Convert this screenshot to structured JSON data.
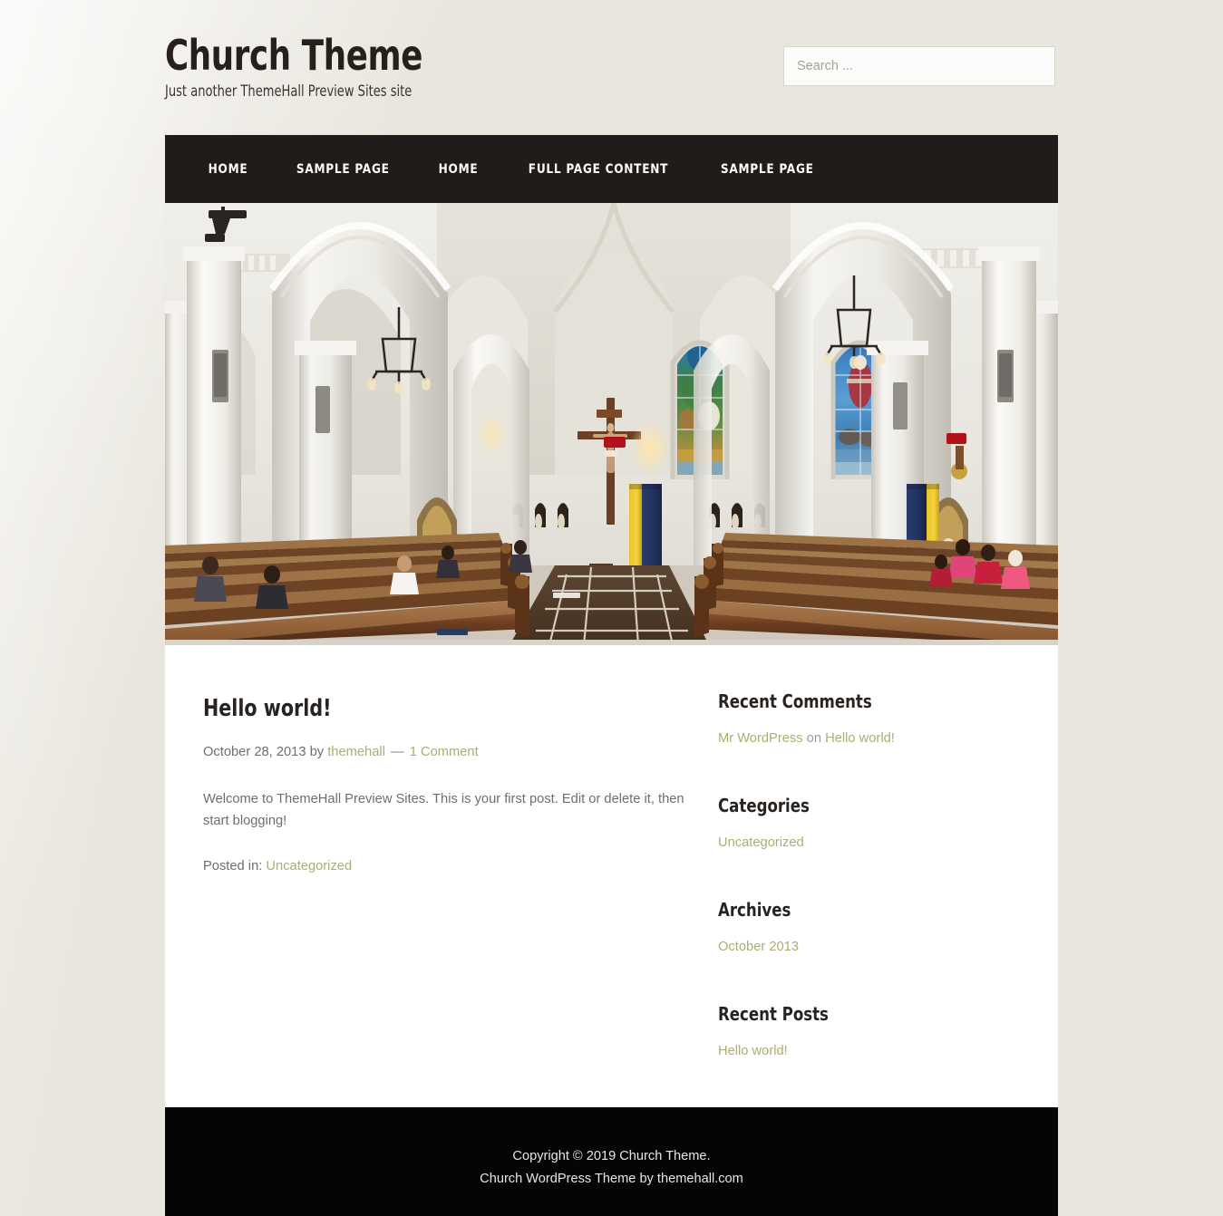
{
  "colors": {
    "page_background": "#e9e6de",
    "nav_background": "#211c1a",
    "footer_background": "#050505",
    "content_background": "#ffffff",
    "link_accent": "#adad72",
    "heading": "#28231f",
    "body_text": "#6e6e6e"
  },
  "header": {
    "site_title": "Church Theme",
    "site_description": "Just another ThemeHall Preview Sites site",
    "search": {
      "placeholder": "Search ...",
      "value": "",
      "icon": "search-icon"
    }
  },
  "nav": {
    "items": [
      {
        "label": "Home"
      },
      {
        "label": "Sample Page"
      },
      {
        "label": "Home"
      },
      {
        "label": "Full Page Content"
      },
      {
        "label": "Sample Page"
      }
    ]
  },
  "hero": {
    "alt": "Church interior with gothic arches, crucifix, stained glass windows and wooden pews",
    "description": "Interior of a white gothic church nave looking toward the altar: a wooden crucifix on the rear wall, two tall stained glass windows, yellow and navy blue vertical banners on the pillars, statue alcoves, hanging chandeliers, rows of dark wooden pews, and a dark brown tiled center aisle"
  },
  "post": {
    "title": "Hello world!",
    "date": "October 28, 2013",
    "by_label": "by",
    "author": "themehall",
    "separator": "—",
    "comments": "1 Comment",
    "body": "Welcome to ThemeHall Preview Sites. This is your first post. Edit or delete it, then start blogging!",
    "posted_in_label": "Posted in:",
    "category": "Uncategorized"
  },
  "sidebar": {
    "widgets": [
      {
        "title": "Recent Comments",
        "comment": {
          "author": "Mr WordPress",
          "on_label": "on",
          "post": "Hello world!"
        }
      },
      {
        "title": "Categories",
        "items": [
          "Uncategorized"
        ]
      },
      {
        "title": "Archives",
        "items": [
          "October 2013"
        ]
      },
      {
        "title": "Recent Posts",
        "items": [
          "Hello world!"
        ]
      }
    ]
  },
  "footer": {
    "line1": "Copyright © 2019 Church Theme.",
    "line2_prefix": "Church WordPress Theme by",
    "line2_link": "themehall.com"
  }
}
